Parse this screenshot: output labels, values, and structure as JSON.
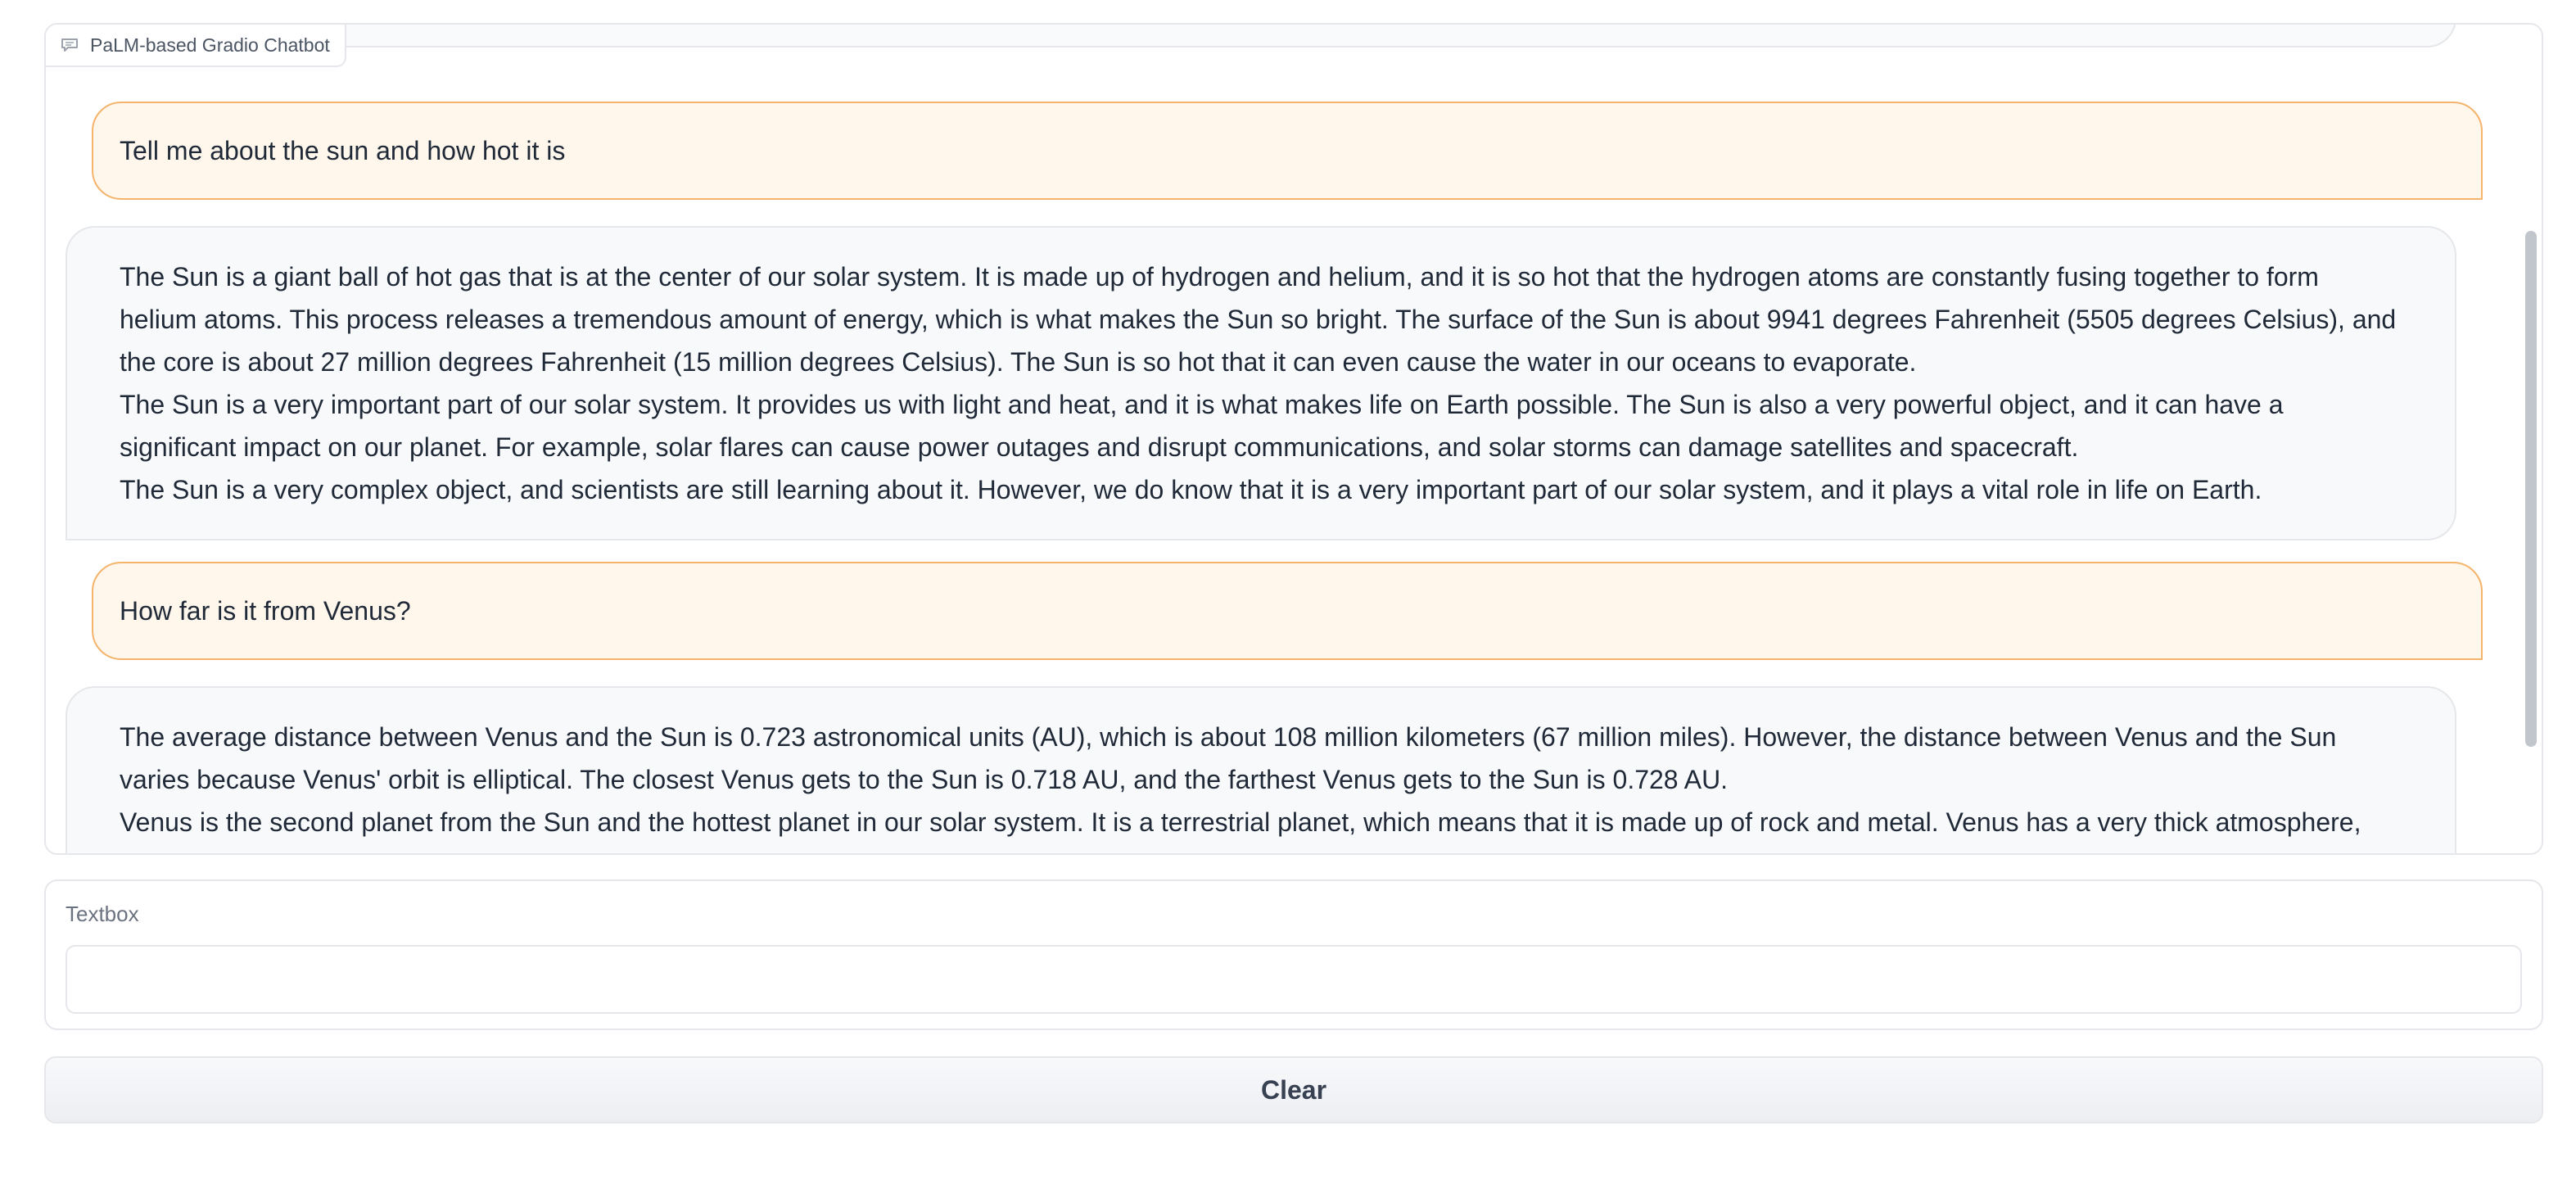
{
  "chatbot": {
    "label": "PaLM-based Gradio Chatbot",
    "label_icon": "chat-icon",
    "messages": [
      {
        "role": "user",
        "paragraphs": [
          "Tell me about the sun and how hot it is"
        ]
      },
      {
        "role": "bot",
        "paragraphs": [
          "The Sun is a giant ball of hot gas that is at the center of our solar system. It is made up of hydrogen and helium, and it is so hot that the hydrogen atoms are constantly fusing together to form helium atoms. This process releases a tremendous amount of energy, which is what makes the Sun so bright. The surface of the Sun is about 9941 degrees Fahrenheit (5505 degrees Celsius), and the core is about 27 million degrees Fahrenheit (15 million degrees Celsius). The Sun is so hot that it can even cause the water in our oceans to evaporate.",
          "The Sun is a very important part of our solar system. It provides us with light and heat, and it is what makes life on Earth possible. The Sun is also a very powerful object, and it can have a significant impact on our planet. For example, solar flares can cause power outages and disrupt communications, and solar storms can damage satellites and spacecraft.",
          "The Sun is a very complex object, and scientists are still learning about it. However, we do know that it is a very important part of our solar system, and it plays a vital role in life on Earth."
        ]
      },
      {
        "role": "user",
        "paragraphs": [
          "How far is it from Venus?"
        ]
      },
      {
        "role": "bot",
        "paragraphs": [
          "The average distance between Venus and the Sun is 0.723 astronomical units (AU), which is about 108 million kilometers (67 million miles). However, the distance between Venus and the Sun varies because Venus' orbit is elliptical. The closest Venus gets to the Sun is 0.718 AU, and the farthest Venus gets to the Sun is 0.728 AU.",
          "Venus is the second planet from the Sun and the hottest planet in our solar system. It is a terrestrial planet, which means that it is made up of rock and metal. Venus has a very thick atmosphere, which is made up"
        ]
      }
    ]
  },
  "textbox": {
    "label": "Textbox",
    "value": "",
    "placeholder": ""
  },
  "clear_button": {
    "label": "Clear"
  },
  "colors": {
    "user_bubble_border": "#f5b46c",
    "user_bubble_bg": "#fff6ec",
    "bot_bubble_border": "#e5e7eb",
    "bot_bubble_bg": "#f8f9fb"
  }
}
